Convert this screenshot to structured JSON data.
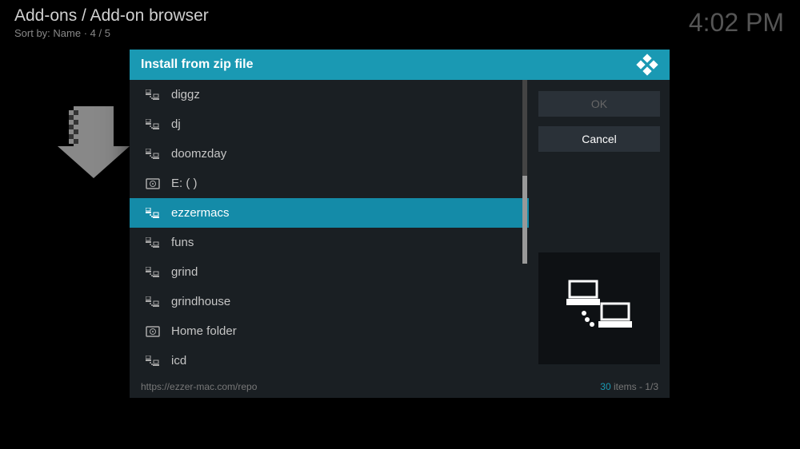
{
  "header": {
    "breadcrumb": "Add-ons / Add-on browser",
    "sort_label": "Sort by: Name  ·  4 / 5",
    "clock": "4:02 PM"
  },
  "dialog": {
    "title": "Install from zip file",
    "files": [
      {
        "name": "diggz",
        "type": "network"
      },
      {
        "name": "dj",
        "type": "network"
      },
      {
        "name": "doomzday",
        "type": "network"
      },
      {
        "name": "E: ( )",
        "type": "drive"
      },
      {
        "name": "ezzermacs",
        "type": "network",
        "selected": true
      },
      {
        "name": "funs",
        "type": "network"
      },
      {
        "name": "grind",
        "type": "network"
      },
      {
        "name": "grindhouse",
        "type": "network"
      },
      {
        "name": "Home folder",
        "type": "drive"
      },
      {
        "name": "icd",
        "type": "network"
      }
    ],
    "buttons": {
      "ok": "OK",
      "cancel": "Cancel"
    },
    "footer": {
      "url": "https://ezzer-mac.com/repo",
      "item_count": "30",
      "items_label": " items",
      "page": " - 1/3"
    }
  }
}
